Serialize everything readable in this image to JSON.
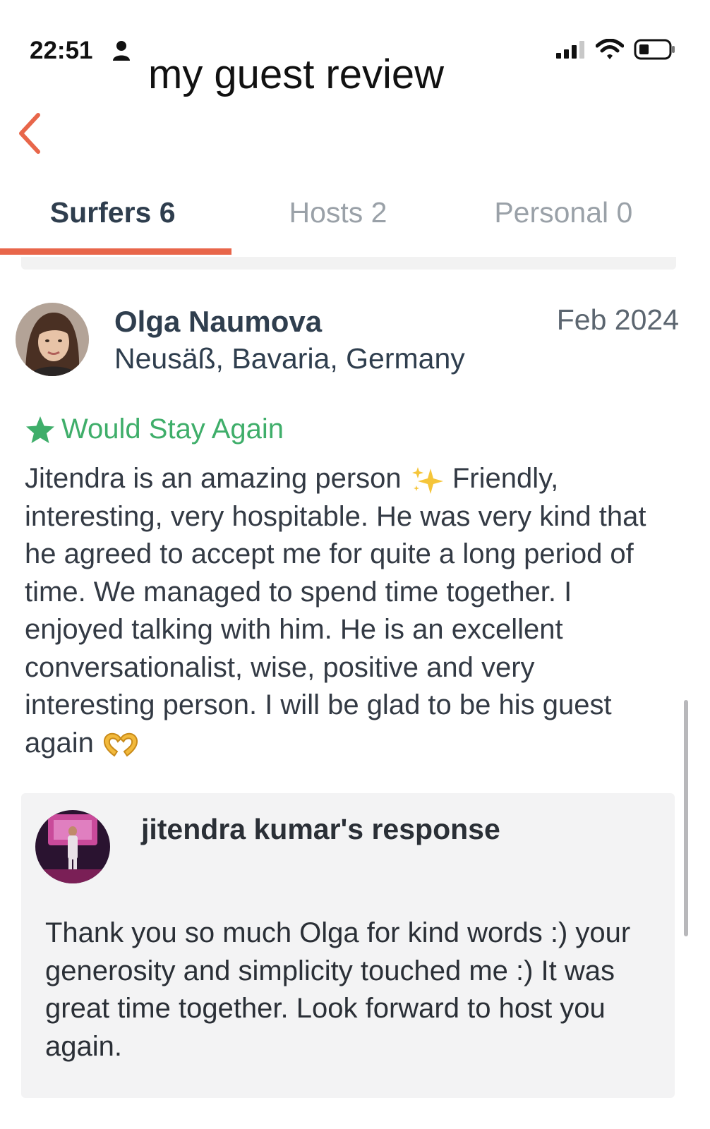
{
  "status_bar": {
    "time": "22:51",
    "icons": [
      "person-icon",
      "signal-icon",
      "wifi-icon",
      "battery-icon"
    ]
  },
  "overlay_title": "my guest review",
  "header": {
    "back_icon": "chevron-left-icon"
  },
  "tabs": [
    {
      "label": "Surfers 6",
      "active": true
    },
    {
      "label": "Hosts 2",
      "active": false
    },
    {
      "label": "Personal 0",
      "active": false
    }
  ],
  "review": {
    "reviewer_name": "Olga Naumova",
    "reviewer_location": "Neusäß, Bavaria, Germany",
    "date": "Feb 2024",
    "recommendation": "Would Stay Again",
    "text_before_emoji": "Jitendra is an amazing person ",
    "text_after_emoji": " Friendly, interesting, very hospitable.  He was very kind that he agreed to accept me for quite a long period of time.  We managed to spend time together.  I enjoyed talking with him.  He is an excellent conversationalist, wise, positive and very interesting person.  I will be glad to be his guest again ",
    "emojis": [
      "sparkles-icon",
      "heart-hands-icon"
    ]
  },
  "response": {
    "title": "jitendra kumar's response",
    "text": "Thank you so much Olga for kind words :) your generosity and simplicity  touched me :) It was great time together. Look forward to host you again."
  },
  "colors": {
    "accent": "#e8664a",
    "green": "#3fae6a",
    "text_dark": "#2f3e4e",
    "tab_inactive": "#9aa1a8"
  }
}
